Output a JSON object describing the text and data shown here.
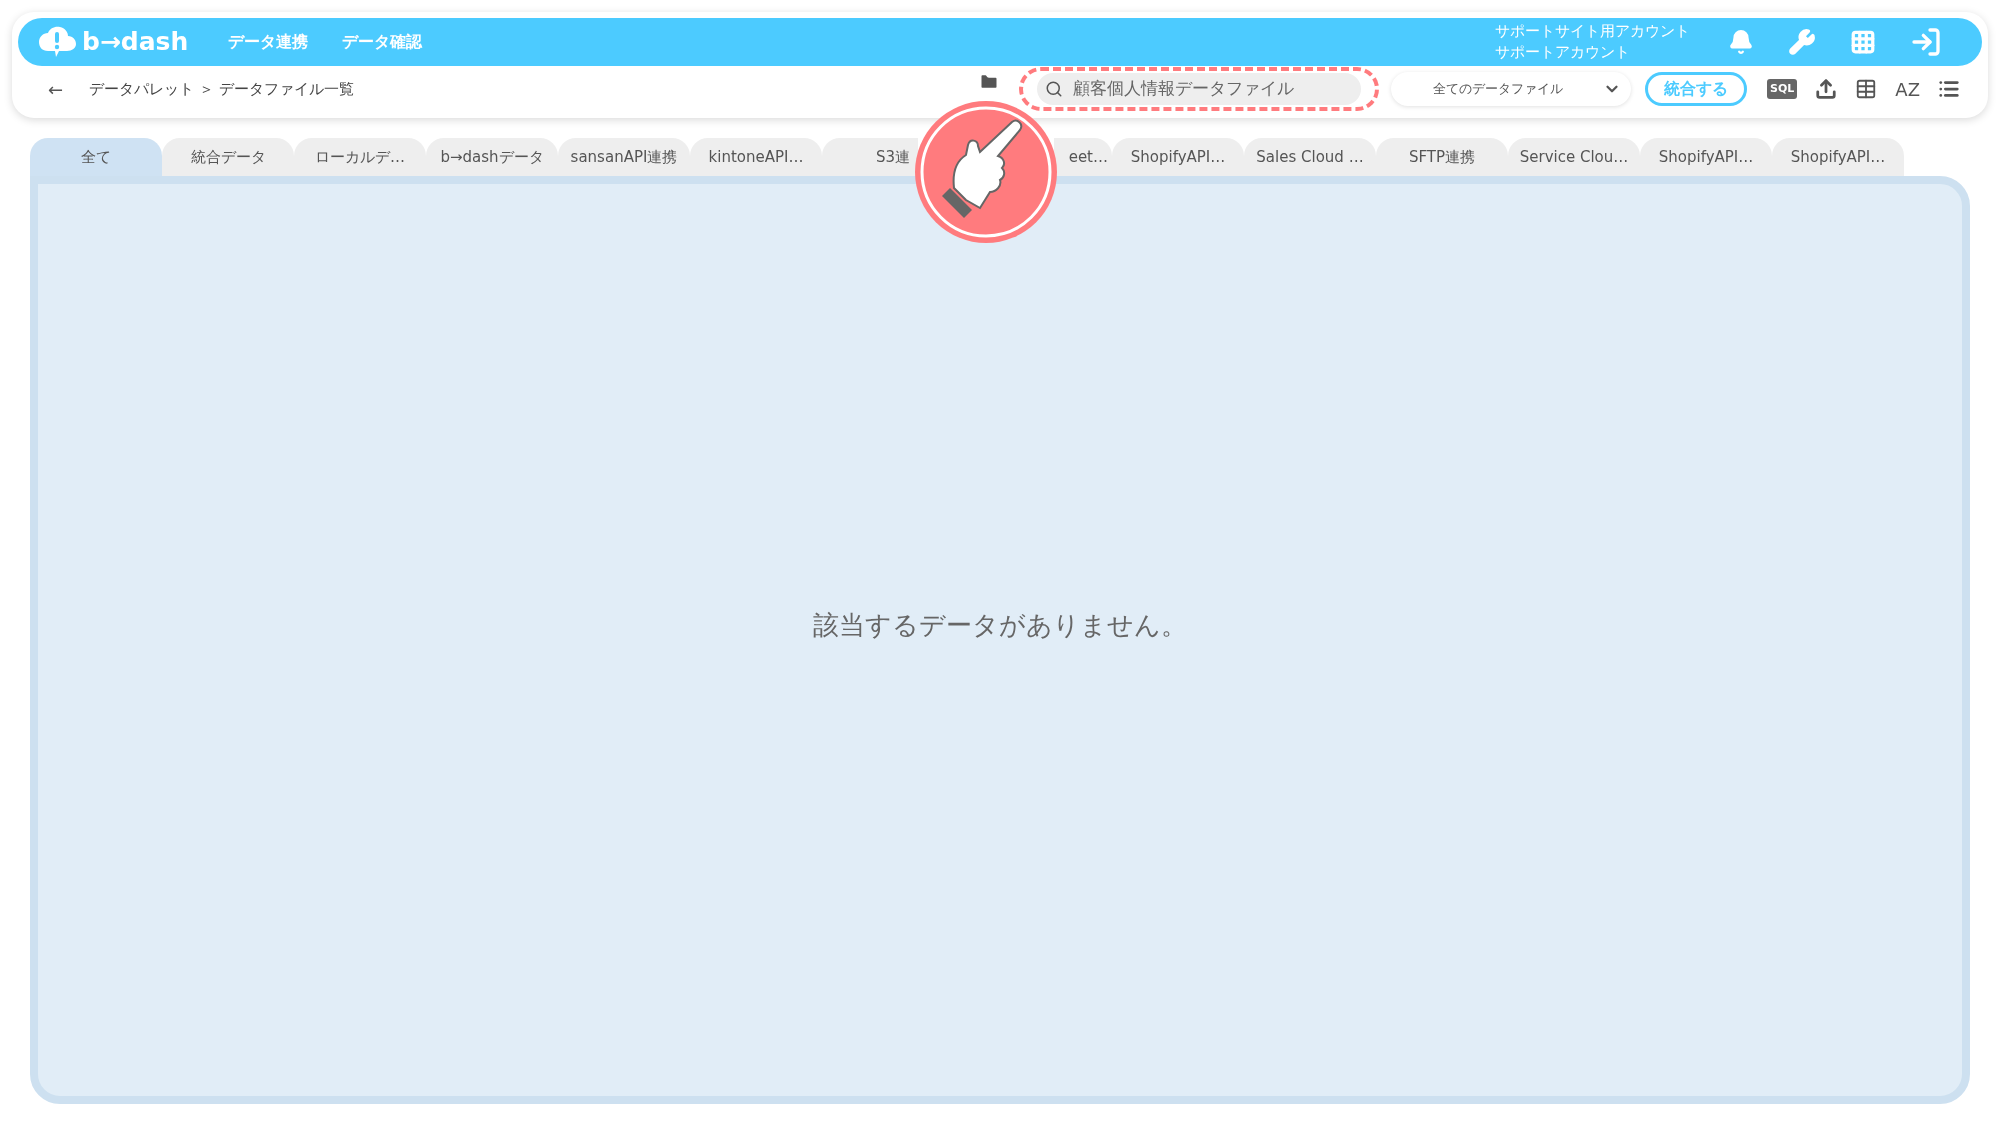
{
  "header": {
    "logo": "b→dash",
    "nav": [
      "データ連携",
      "データ確認"
    ],
    "account": {
      "line1": "サポートサイト用アカウント",
      "line2": "サポートアカウント"
    }
  },
  "toolbar": {
    "back": "←",
    "breadcrumb": "データパレット ＞ データファイル一覧",
    "search": {
      "value": "顧客個人情報データファイル",
      "highlighted": true
    },
    "filter": "全てのデータファイル",
    "merge_button": "統合する",
    "sql": "SQL",
    "sort": "AZ"
  },
  "tabs": [
    {
      "label": "全て",
      "selected": true
    },
    {
      "label": "統合データ",
      "selected": false
    },
    {
      "label": "ローカルデ…",
      "selected": false
    },
    {
      "label": "b→dashデータ",
      "selected": false
    },
    {
      "label": "sansanAPI連携",
      "selected": false
    },
    {
      "label": "kintoneAPI…",
      "selected": false
    },
    {
      "label": "S3連",
      "selected": false,
      "kind": "leading"
    },
    {
      "label": "eet…",
      "selected": false,
      "kind": "trailing"
    },
    {
      "label": "ShopifyAPI…",
      "selected": false
    },
    {
      "label": "Sales Cloud …",
      "selected": false
    },
    {
      "label": "SFTP連携",
      "selected": false
    },
    {
      "label": "Service Clou…",
      "selected": false
    },
    {
      "label": "ShopifyAPI…",
      "selected": false
    },
    {
      "label": "ShopifyAPI…",
      "selected": false
    }
  ],
  "empty_message": "該当するデータがありません。"
}
